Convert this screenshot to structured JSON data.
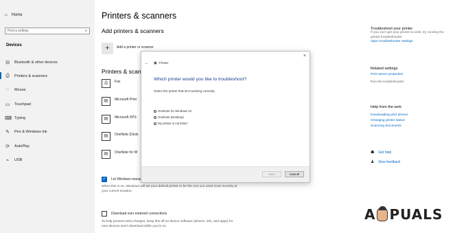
{
  "sidebar": {
    "home": "Home",
    "search_placeholder": "Find a setting",
    "section": "Devices",
    "items": [
      {
        "label": "Bluetooth & other devices",
        "icon": "bluetooth-icon"
      },
      {
        "label": "Printers & scanners",
        "icon": "printer-icon"
      },
      {
        "label": "Mouse",
        "icon": "mouse-icon"
      },
      {
        "label": "Touchpad",
        "icon": "touchpad-icon"
      },
      {
        "label": "Typing",
        "icon": "keyboard-icon"
      },
      {
        "label": "Pen & Windows Ink",
        "icon": "pen-icon"
      },
      {
        "label": "AutoPlay",
        "icon": "autoplay-icon"
      },
      {
        "label": "USB",
        "icon": "usb-icon"
      }
    ]
  },
  "main": {
    "title": "Printers & scanners",
    "add_heading": "Add printers & scanners",
    "add_label": "Add a printer or scanner",
    "list_heading": "Printers & scanners",
    "printers": [
      "Fax",
      "Microsoft Print",
      "Microsoft XPS",
      "OneNote (Desk",
      "OneNote for W"
    ],
    "default_checkbox": "Let Windows manage my default printer",
    "default_desc": "When this is on, Windows will set your default printer to be the one you used most recently at your current location.",
    "metered_checkbox": "Download over metered connections",
    "metered_desc": "To help prevent extra charges, keep this off so device software (drivers, info, and apps) for new devices won't download while you're on"
  },
  "right": {
    "troubleshoot_heading": "Troubleshoot your printer",
    "troubleshoot_text": "If you can't get your printer to work, try running the printer troubleshooter.",
    "troubleshoot_link": "Open troubleshooter settings",
    "related_heading": "Related settings",
    "print_server_link": "Print server properties",
    "run_troubleshooter": "Run the troubleshooter",
    "help_heading": "Help from the web",
    "links": [
      "Downloading print drivers",
      "Changing printer status",
      "Scanning documents"
    ],
    "get_help": "Get help",
    "give_feedback": "Give feedback"
  },
  "dialog": {
    "app_title": "Printer",
    "heading": "Which printer would you like to troubleshoot?",
    "instruction": "Select the printer that isn't working correctly.",
    "options": [
      "OneNote for Windows 10",
      "OneNote (Desktop)",
      "My printer is not listed"
    ],
    "next": "Next",
    "cancel": "Cancel",
    "close": "×",
    "back": "←"
  },
  "watermark": {
    "left": "A",
    "right": "PUALS"
  }
}
